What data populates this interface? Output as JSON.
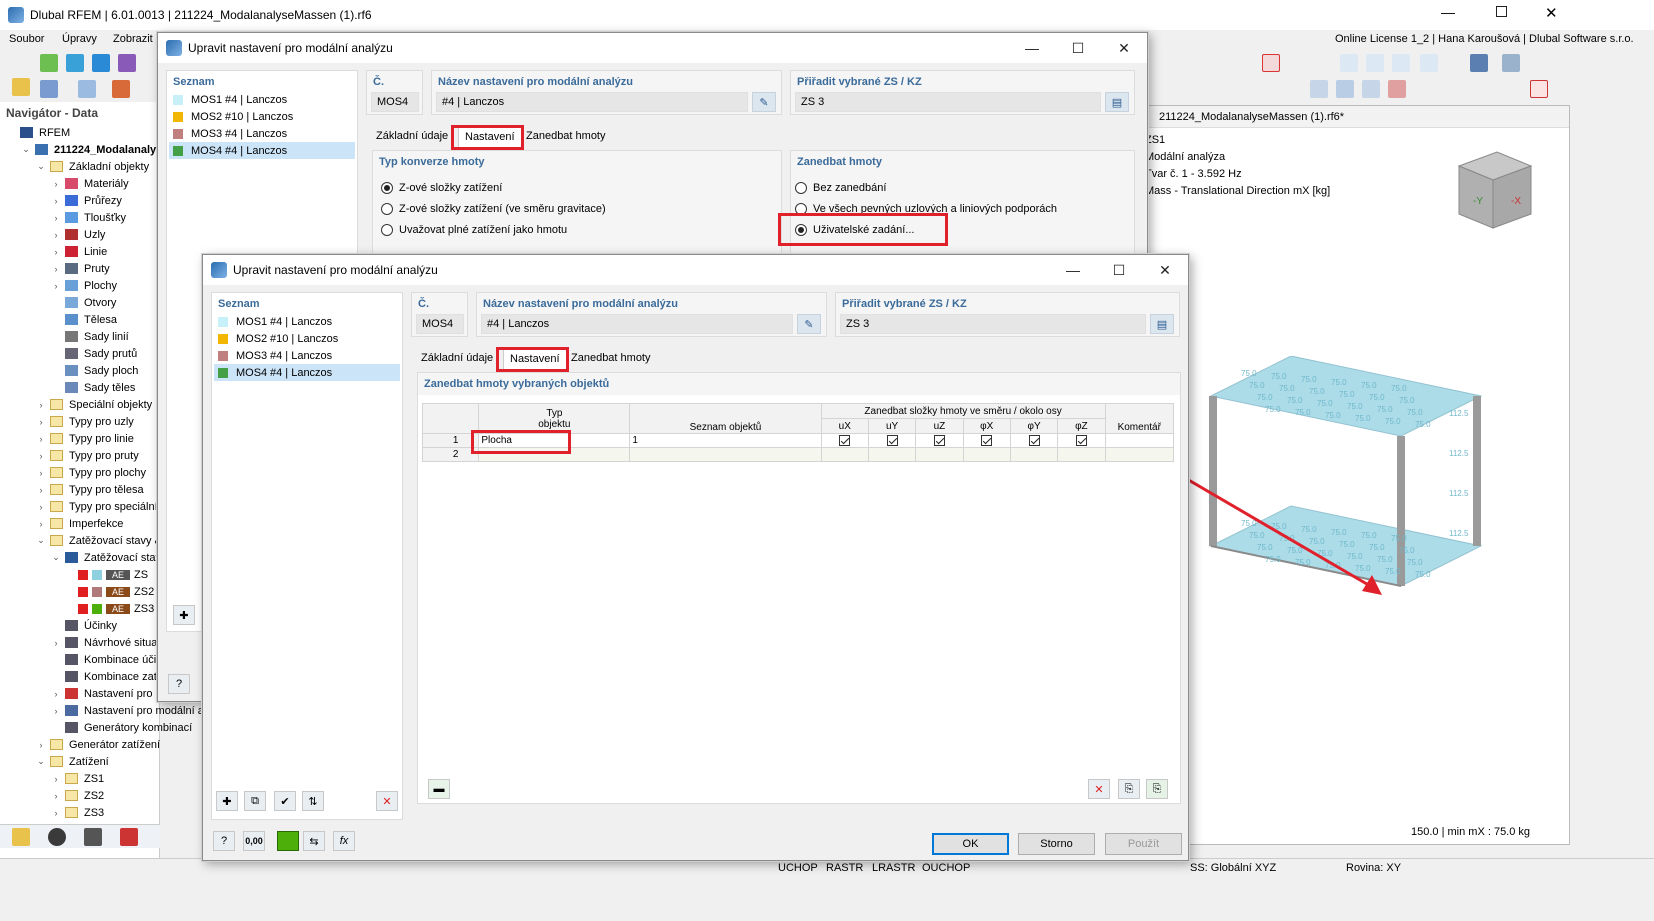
{
  "app": {
    "title": "Dlubal RFEM | 6.01.0013 | 211224_ModalanalyseMassen (1).rf6",
    "license": "Online License 1_2 | Hana Karoušová | Dlubal Software s.r.o.",
    "menu": [
      "Soubor",
      "Úpravy",
      "Zobrazit"
    ]
  },
  "navigator": {
    "title": "Navigátor - Data",
    "items": [
      {
        "label": "RFEM",
        "indent": 0,
        "exp": "",
        "icon": "rfem"
      },
      {
        "label": "211224_Modalanalyse",
        "indent": 1,
        "exp": "⌄",
        "icon": "model",
        "bold": true
      },
      {
        "label": "Základní objekty",
        "indent": 2,
        "exp": "⌄",
        "icon": "folder"
      },
      {
        "label": "Materiály",
        "indent": 3,
        "exp": "›",
        "icon": "materials"
      },
      {
        "label": "Průřezy",
        "indent": 3,
        "exp": "›",
        "icon": "sections"
      },
      {
        "label": "Tloušťky",
        "indent": 3,
        "exp": "›",
        "icon": "thickness"
      },
      {
        "label": "Uzly",
        "indent": 3,
        "exp": "›",
        "icon": "nodes"
      },
      {
        "label": "Linie",
        "indent": 3,
        "exp": "›",
        "icon": "lines"
      },
      {
        "label": "Pruty",
        "indent": 3,
        "exp": "›",
        "icon": "members"
      },
      {
        "label": "Plochy",
        "indent": 3,
        "exp": "›",
        "icon": "surfaces"
      },
      {
        "label": "Otvory",
        "indent": 3,
        "exp": "",
        "icon": "openings"
      },
      {
        "label": "Tělesa",
        "indent": 3,
        "exp": "",
        "icon": "solids"
      },
      {
        "label": "Sady linií",
        "indent": 3,
        "exp": "",
        "icon": "linesets"
      },
      {
        "label": "Sady prutů",
        "indent": 3,
        "exp": "",
        "icon": "membersets"
      },
      {
        "label": "Sady ploch",
        "indent": 3,
        "exp": "",
        "icon": "surfacesets"
      },
      {
        "label": "Sady těles",
        "indent": 3,
        "exp": "",
        "icon": "solidsets"
      },
      {
        "label": "Speciální objekty",
        "indent": 2,
        "exp": "›",
        "icon": "folder"
      },
      {
        "label": "Typy pro uzly",
        "indent": 2,
        "exp": "›",
        "icon": "folder"
      },
      {
        "label": "Typy pro linie",
        "indent": 2,
        "exp": "›",
        "icon": "folder"
      },
      {
        "label": "Typy pro pruty",
        "indent": 2,
        "exp": "›",
        "icon": "folder"
      },
      {
        "label": "Typy pro plochy",
        "indent": 2,
        "exp": "›",
        "icon": "folder"
      },
      {
        "label": "Typy pro tělesa",
        "indent": 2,
        "exp": "›",
        "icon": "folder"
      },
      {
        "label": "Typy pro speciální o",
        "indent": 2,
        "exp": "›",
        "icon": "folder"
      },
      {
        "label": "Imperfekce",
        "indent": 2,
        "exp": "›",
        "icon": "folder"
      },
      {
        "label": "Zatěžovací stavy &",
        "indent": 2,
        "exp": "⌄",
        "icon": "folder"
      },
      {
        "label": "Zatěžovací stav",
        "indent": 3,
        "exp": "⌄",
        "icon": "loadcase"
      },
      {
        "label": "ZS",
        "indent": 4,
        "exp": "",
        "icon": "ae1"
      },
      {
        "label": "ZS2",
        "indent": 4,
        "exp": "",
        "icon": "ae2"
      },
      {
        "label": "ZS3",
        "indent": 4,
        "exp": "",
        "icon": "ae3"
      },
      {
        "label": "Účinky",
        "indent": 3,
        "exp": "",
        "icon": "actions"
      },
      {
        "label": "Návrhové situac",
        "indent": 3,
        "exp": "›",
        "icon": "actions"
      },
      {
        "label": "Kombinace účin",
        "indent": 3,
        "exp": "",
        "icon": "actions"
      },
      {
        "label": "Kombinace zatí",
        "indent": 3,
        "exp": "",
        "icon": "actions"
      },
      {
        "label": "Nastavení pro",
        "indent": 3,
        "exp": "›",
        "icon": "settings"
      },
      {
        "label": "Nastavení pro modální a",
        "indent": 3,
        "exp": "›",
        "icon": "modal"
      },
      {
        "label": "Generátory kombinací",
        "indent": 3,
        "exp": "",
        "icon": "actions"
      },
      {
        "label": "Generátor zatížení",
        "indent": 2,
        "exp": "›",
        "icon": "folder"
      },
      {
        "label": "Zatížení",
        "indent": 2,
        "exp": "⌄",
        "icon": "folder"
      },
      {
        "label": "ZS1",
        "indent": 3,
        "exp": "›",
        "icon": "folder"
      },
      {
        "label": "ZS2",
        "indent": 3,
        "exp": "›",
        "icon": "folder"
      },
      {
        "label": "ZS3",
        "indent": 3,
        "exp": "›",
        "icon": "folder"
      }
    ],
    "ae_label": "AE"
  },
  "viewport": {
    "title": "211224_ModalanalyseMassen (1).rf6*",
    "info": [
      "ZS1",
      "Modální analýza",
      "Tvar č. 1 - 3.592 Hz",
      "Mass - Translational Direction mX [kg]"
    ],
    "footer": "150.0 | min mX : 75.0 kg",
    "label_small": "75.0",
    "label_edge": "112.5"
  },
  "statusbar": {
    "items": [
      "UCHOP",
      "RASTR",
      "LRASTR",
      "OUCHOP"
    ],
    "cs": "SS: Globální XYZ",
    "plane": "Rovina: XY"
  },
  "dialog1": {
    "title": "Upravit nastavení pro modální analýzu",
    "list_header": "Seznam",
    "rows": [
      {
        "id": "MOS1",
        "desc": "#4 | Lanczos",
        "color": "#c8f0f8"
      },
      {
        "id": "MOS2",
        "desc": "#10 | Lanczos",
        "color": "#f2b705"
      },
      {
        "id": "MOS3",
        "desc": "#4 | Lanczos",
        "color": "#c08080"
      },
      {
        "id": "MOS4",
        "desc": "#4 | Lanczos",
        "color": "#43a047"
      }
    ],
    "no_header": "Č.",
    "no_value": "MOS4",
    "name_header": "Název nastavení pro modální analýzu",
    "name_value": "#4 | Lanczos",
    "assign_header": "Přiřadit vybrané ZS / KZ",
    "assign_value": "ZS 3",
    "tabs": [
      "Základní údaje",
      "Nastavení",
      "Zanedbat hmoty"
    ],
    "conv_header": "Typ konverze hmoty",
    "conv_options": [
      "Z-ové složky zatížení",
      "Z-ové složky zatížení (ve směru gravitace)",
      "Uvažovat plné zatížení jako hmotu"
    ],
    "neglect_header": "Zanedbat hmoty",
    "neglect_options": [
      "Bez zanedbání",
      "Ve všech pevných uzlových a liniových podporách",
      "Uživatelské zadání..."
    ]
  },
  "dialog2": {
    "title": "Upravit nastavení pro modální analýzu",
    "tabs": [
      "Základní údaje",
      "Nastavení",
      "Zanedbat hmoty"
    ],
    "section_header": "Zanedbat hmoty vybraných objektů",
    "table": {
      "type_header": [
        "Typ",
        "objektu"
      ],
      "list_header": "Seznam objektů",
      "group_header": "Zanedbat složky hmoty ve směru / okolo osy",
      "comp_headers": [
        "uX",
        "uY",
        "uZ",
        "φX",
        "φY",
        "φZ"
      ],
      "comment_header": "Komentář",
      "rows": [
        {
          "no": "1",
          "type": "Plocha",
          "list": "1",
          "checks": [
            true,
            true,
            true,
            true,
            true,
            true
          ]
        },
        {
          "no": "2",
          "type": "",
          "list": "",
          "checks": []
        }
      ]
    },
    "buttons": {
      "ok": "OK",
      "cancel": "Storno",
      "apply": "Použít"
    },
    "zero_label": "0,00"
  },
  "colors": {
    "accent": "#e0202a",
    "header_blue": "#3a6b9a",
    "selection": "#cce4f7",
    "grid_light": "#8fd0dc"
  }
}
